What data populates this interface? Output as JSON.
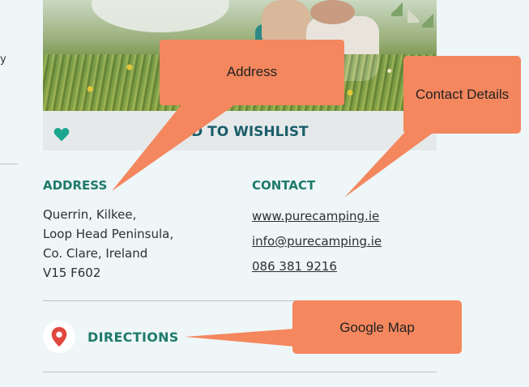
{
  "wishlist": {
    "label": "DD TO WISHLIST"
  },
  "address": {
    "heading": "ADDRESS",
    "lines": [
      "Querrin, Kilkee,",
      "Loop Head Peninsula,",
      "Co. Clare, Ireland",
      "V15 F602"
    ]
  },
  "contact": {
    "heading": "CONTACT",
    "website": "www.purecamping.ie",
    "email": "info@purecamping.ie",
    "phone": "086 381 9216"
  },
  "directions": {
    "label": "DIRECTIONS"
  },
  "left_fragment": "y",
  "callouts": {
    "address": "Address",
    "contact": "Contact Details",
    "map": "Google Map"
  },
  "colors": {
    "callout": "#f4875e",
    "heading": "#1f7a6a",
    "heart": "#1aa58f",
    "pin": "#e0473e"
  }
}
